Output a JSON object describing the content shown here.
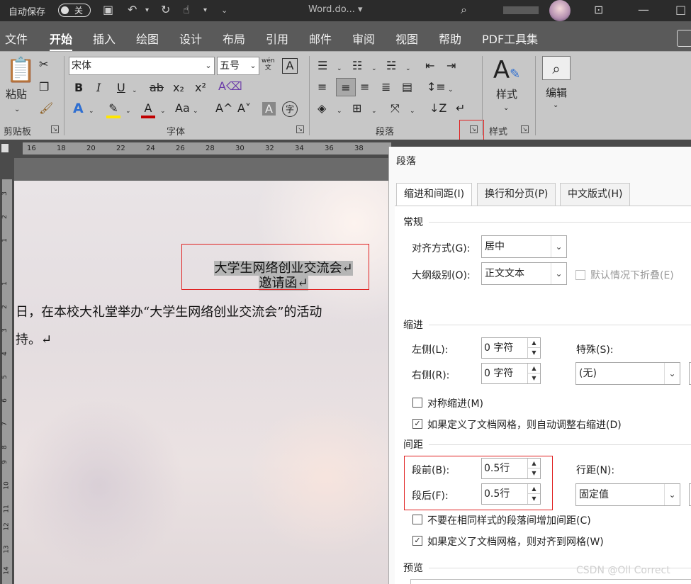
{
  "titlebar": {
    "autosave_label": "自动保存",
    "autosave_state": "关",
    "doc_name": "Word.do... ▾"
  },
  "tabs": [
    "文件",
    "开始",
    "插入",
    "绘图",
    "设计",
    "布局",
    "引用",
    "邮件",
    "审阅",
    "视图",
    "帮助",
    "PDF工具集"
  ],
  "ribbon": {
    "clipboard": {
      "paste": "粘贴",
      "label": "剪贴板"
    },
    "font": {
      "name": "宋体",
      "size": "五号",
      "label": "字体",
      "phonetic_top": "wén",
      "phonetic_bottom": "文",
      "border_char": "A",
      "bold": "B",
      "italic": "I",
      "underline": "U",
      "strike": "ab",
      "sub": "x₂",
      "sup": "x²",
      "grow": "A^",
      "shrink": "A˅",
      "case": "Aa",
      "shade_char": "A",
      "enclose_char": "字"
    },
    "paragraph": {
      "label": "段落"
    },
    "styles": {
      "button": "样式",
      "label": "样式"
    },
    "editing": {
      "button": "编辑"
    }
  },
  "ruler": {
    "h_numbers": [
      "16",
      "18",
      "20",
      "22",
      "24",
      "26",
      "28",
      "30",
      "32",
      "34",
      "36",
      "38"
    ],
    "v_numbers": [
      "3",
      "2",
      "1",
      "1",
      "2",
      "3",
      "4",
      "5",
      "6",
      "7",
      "8",
      "9",
      "10",
      "11",
      "12",
      "13",
      "14"
    ]
  },
  "document": {
    "title_line1": "大学生网络创业交流会↵",
    "title_line2": "邀请函↵",
    "body_line1": "日，在本校大礼堂举办“大学生网络创业交流会”的活动",
    "body_line2": "持。↵"
  },
  "dialog": {
    "title": "段落",
    "tabs": [
      "缩进和间距(I)",
      "换行和分页(P)",
      "中文版式(H)"
    ],
    "general": {
      "header": "常规",
      "alignment_label": "对齐方式(G):",
      "alignment_value": "居中",
      "outline_label": "大纲级别(O):",
      "outline_value": "正文文本",
      "collapse_label": "默认情况下折叠(E)"
    },
    "indent": {
      "header": "缩进",
      "left_label": "左侧(L):",
      "left_value": "0 字符",
      "right_label": "右侧(R):",
      "right_value": "0 字符",
      "special_label": "特殊(S):",
      "special_value": "(无)",
      "mirror_label": "对称缩进(M)",
      "auto_adjust_label": "如果定义了文档网格，则自动调整右缩进(D)"
    },
    "spacing": {
      "header": "间距",
      "before_label": "段前(B):",
      "before_value": "0.5行",
      "after_label": "段后(F):",
      "after_value": "0.5行",
      "line_label": "行距(N):",
      "line_value": "固定值",
      "no_space_label": "不要在相同样式的段落间增加间距(C)",
      "snap_grid_label": "如果定义了文档网格，则对齐到网格(W)"
    },
    "preview": {
      "header": "预览"
    }
  },
  "watermark": "CSDN @Oll Correct",
  "colors": {
    "highlight": "#ffe600",
    "font_color": "#c00000",
    "annotation": "#e02020",
    "text_effect": "#2f6fd1"
  }
}
